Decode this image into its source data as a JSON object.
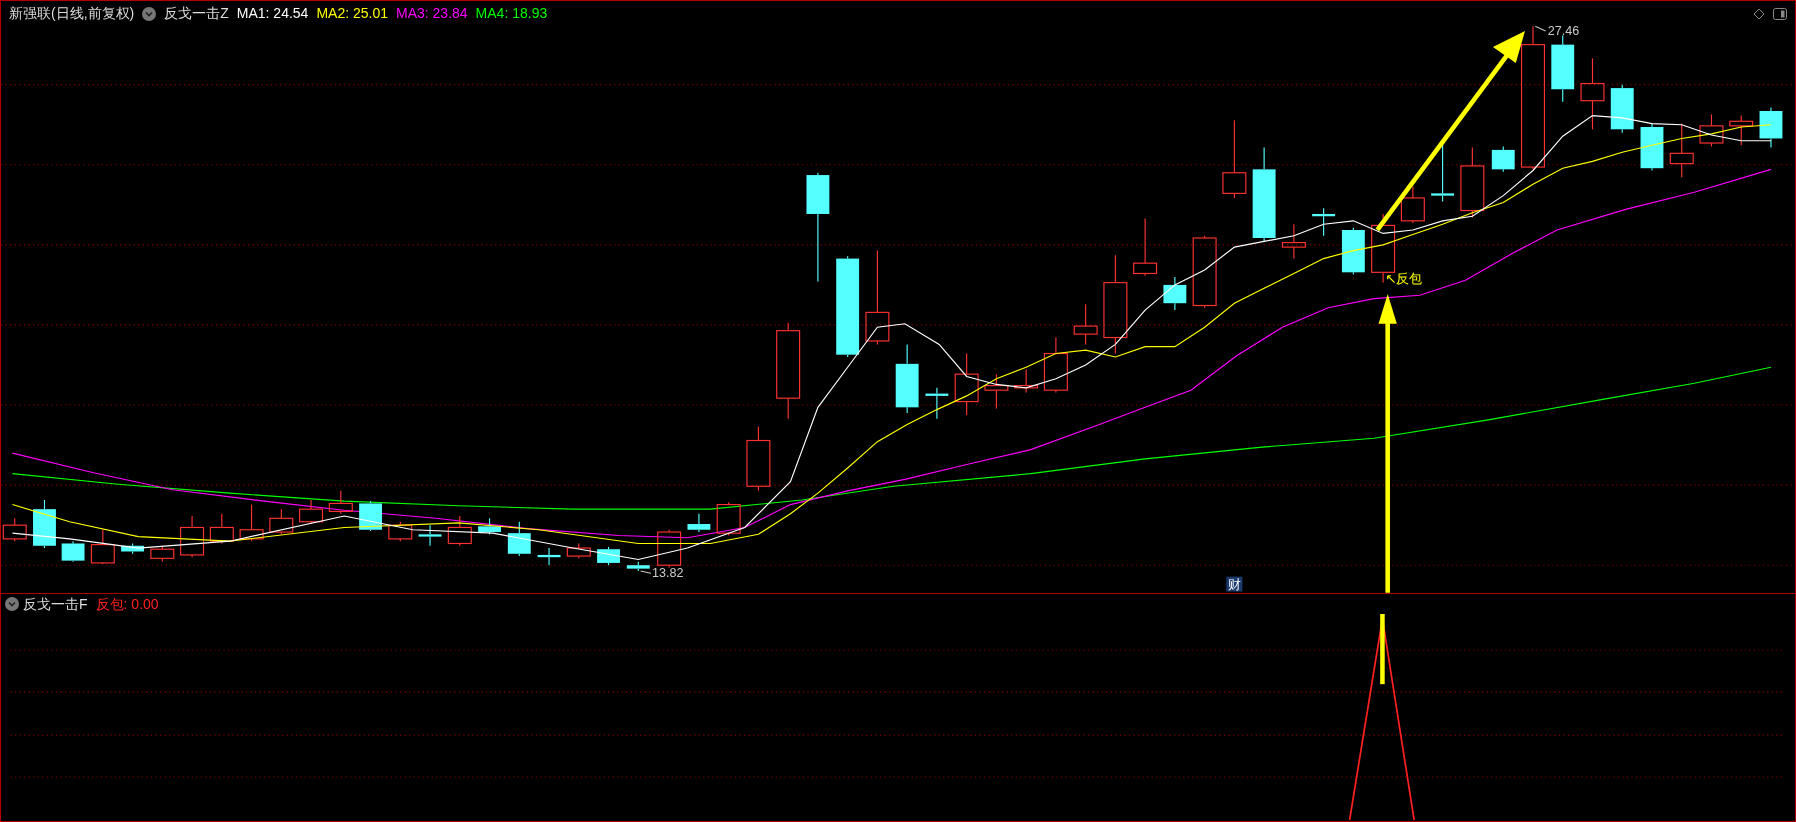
{
  "main_pane": {
    "stock_title": "新强联(日线,前复权)",
    "indicator": "反戈一击Z",
    "ma_readings": [
      {
        "label": "MA1: 24.54",
        "color": "#ffffff"
      },
      {
        "label": "MA2: 25.01",
        "color": "#ffff00"
      },
      {
        "label": "MA3: 23.84",
        "color": "#ff00ff"
      },
      {
        "label": "MA4: 18.93",
        "color": "#00ff00"
      }
    ],
    "high_label": "27.46",
    "low_label": "13.82",
    "signal_label": "反包",
    "finance_badge": "财"
  },
  "sub_pane": {
    "indicator": "反戈一击F",
    "reading": "反包: 0.00"
  }
}
